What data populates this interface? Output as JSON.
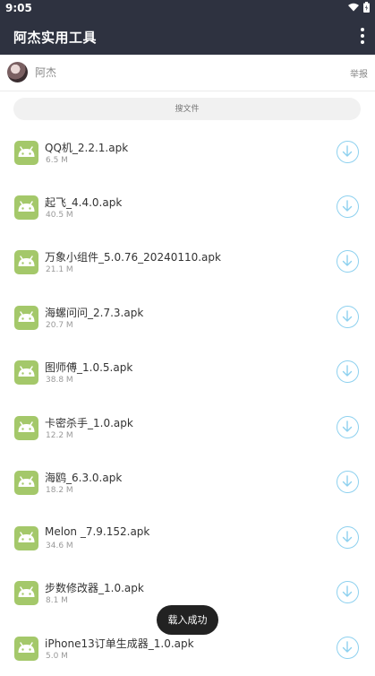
{
  "status_bar": {
    "time": "9:05"
  },
  "app_bar": {
    "title": "阿杰实用工具"
  },
  "user": {
    "name": "阿杰",
    "report_label": "举报"
  },
  "search": {
    "placeholder": "搜文件"
  },
  "files": [
    {
      "name": "QQ机_2.2.1.apk",
      "size": "6.5 M"
    },
    {
      "name": "起飞_4.4.0.apk",
      "size": "40.5 M"
    },
    {
      "name": "万象小组件_5.0.76_20240110.apk",
      "size": "21.1 M"
    },
    {
      "name": "海螺问问_2.7.3.apk",
      "size": "20.7 M"
    },
    {
      "name": "图师傅_1.0.5.apk",
      "size": "38.8 M"
    },
    {
      "name": "卡密杀手_1.0.apk",
      "size": "12.2 M"
    },
    {
      "name": "海鸥_6.3.0.apk",
      "size": "18.2 M"
    },
    {
      "name": "Melon _7.9.152.apk",
      "size": "34.6 M"
    },
    {
      "name": "步数修改器_1.0.apk",
      "size": "8.1 M"
    },
    {
      "name": "iPhone13订单生成器_1.0.apk",
      "size": "5.0 M"
    }
  ],
  "toast": {
    "message": "载入成功"
  },
  "colors": {
    "bar": "#2e3240",
    "apk_icon": "#a4c86a",
    "download_ring": "#8ed1ef"
  },
  "icons": {
    "status": [
      "wifi-icon",
      "battery-icon"
    ],
    "menu": "more-vert-icon",
    "file": "android-apk-icon",
    "download": "download-arrow-icon"
  }
}
